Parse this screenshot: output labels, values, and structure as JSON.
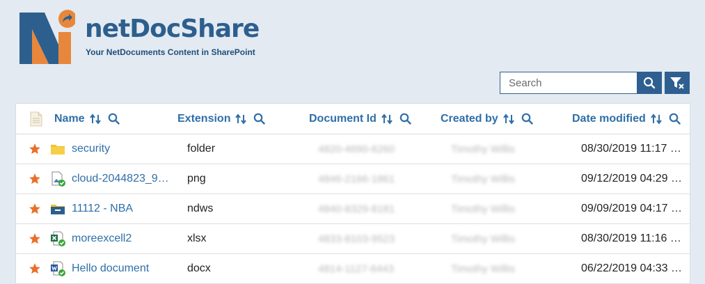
{
  "app": {
    "brand": "netDocShare",
    "tagline": "Your NetDocuments Content in SharePoint",
    "colors": {
      "brand_blue": "#2d5f8e",
      "brand_orange": "#e8873c",
      "link": "#2f6fa8",
      "star": "#e8702a"
    }
  },
  "toolbar": {
    "search_placeholder": "Search",
    "search_icon": "search-icon",
    "filter_icon": "filter-clear-icon"
  },
  "table": {
    "columns": [
      {
        "label": "Name"
      },
      {
        "label": "Extension"
      },
      {
        "label": "Document Id"
      },
      {
        "label": "Created by"
      },
      {
        "label": "Date modified"
      }
    ],
    "rows": [
      {
        "favorite": true,
        "icon": "folder-icon",
        "name": "security",
        "extension": "folder",
        "document_id": "4820-4690-6260",
        "created_by": "Timothy Willis",
        "date_modified": "08/30/2019 11:17 …"
      },
      {
        "favorite": true,
        "icon": "image-file-icon",
        "name": "cloud-2044823_9…",
        "extension": "png",
        "document_id": "4846-2166-1861",
        "created_by": "Timothy Willis",
        "date_modified": "09/12/2019 04:29 …"
      },
      {
        "favorite": true,
        "icon": "ndws-folder-icon",
        "name": "11112 - NBA",
        "extension": "ndws",
        "document_id": "4840-8329-8181",
        "created_by": "Timothy Willis",
        "date_modified": "09/09/2019 04:17 …"
      },
      {
        "favorite": true,
        "icon": "excel-file-icon",
        "name": "moreexcell2",
        "extension": "xlsx",
        "document_id": "4833-8103-9523",
        "created_by": "Timothy Willis",
        "date_modified": "08/30/2019 11:16 …"
      },
      {
        "favorite": true,
        "icon": "word-file-icon",
        "name": "Hello document",
        "extension": "docx",
        "document_id": "4814-1127-6443",
        "created_by": "Timothy Willis",
        "date_modified": "06/22/2019 04:33 …"
      }
    ]
  }
}
